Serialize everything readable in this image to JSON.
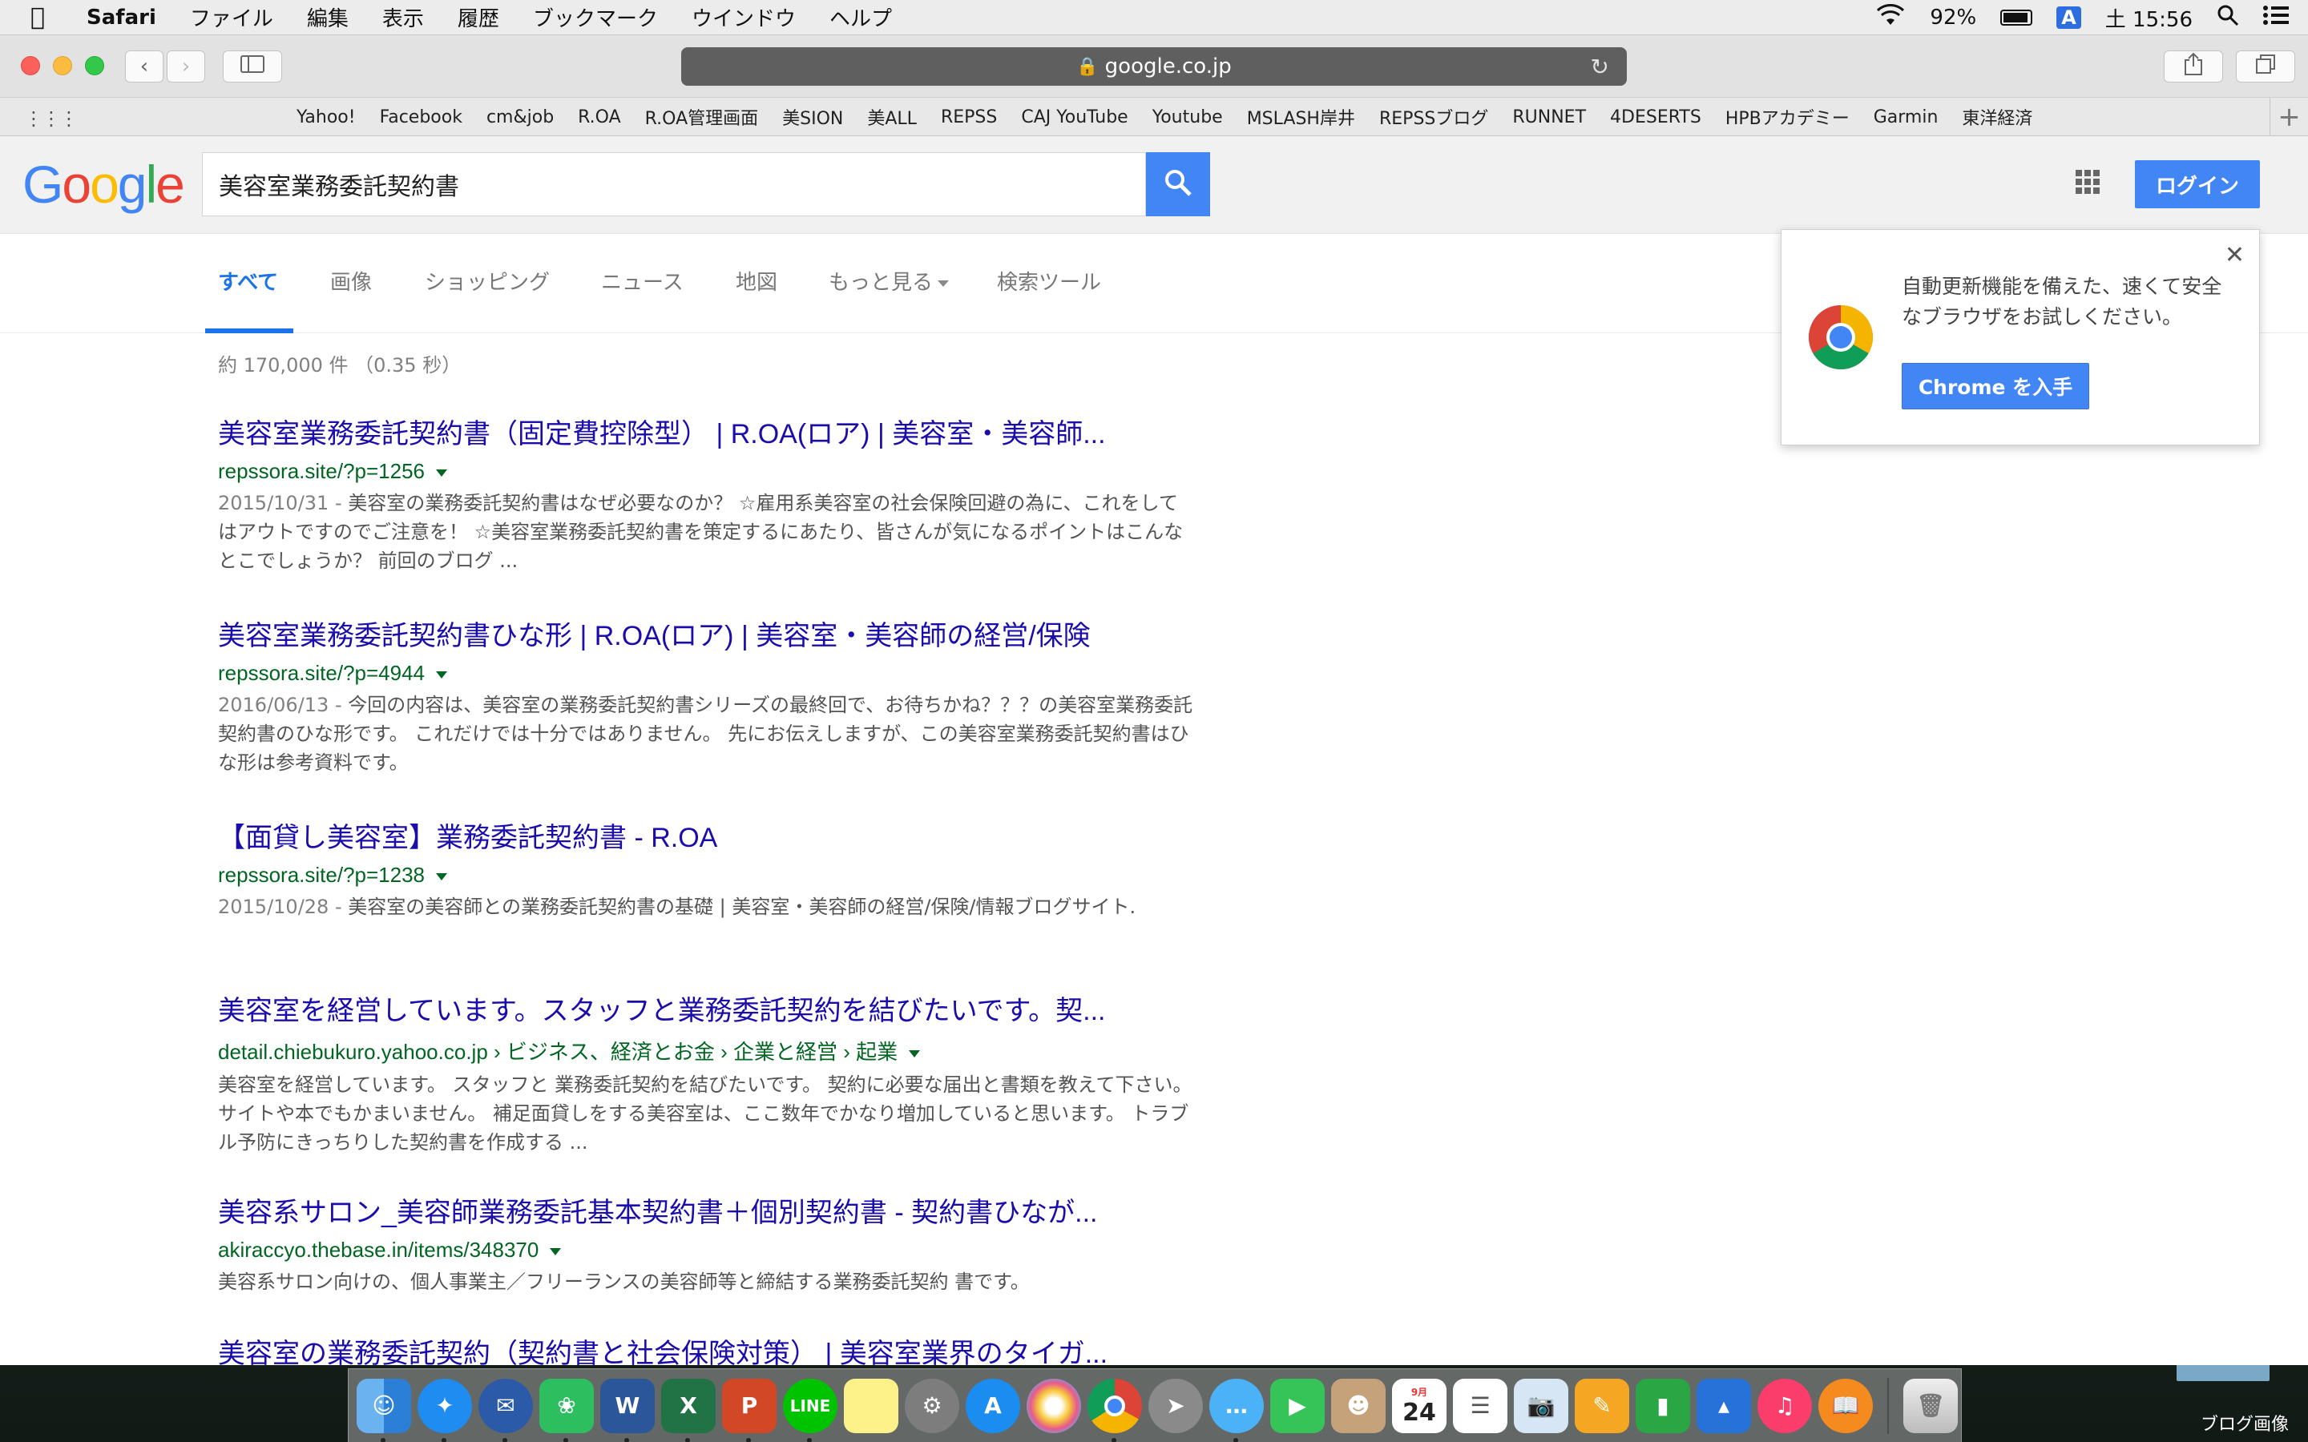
{
  "menubar": {
    "app_name": "Safari",
    "menus": [
      "ファイル",
      "編集",
      "表示",
      "履歴",
      "ブックマーク",
      "ウインドウ",
      "ヘルプ"
    ],
    "battery": "92%",
    "input_mode": "A",
    "clock": "土 15:56"
  },
  "browser": {
    "url": "google.co.jp",
    "bookmarks": [
      "Yahoo!",
      "Facebook",
      "cm&job",
      "R.OA",
      "R.OA管理画面",
      "美SION",
      "美ALL",
      "REPSS",
      "CAJ YouTube",
      "Youtube",
      "MSLASH岸井",
      "REPSSブログ",
      "RUNNET",
      "4DESERTS",
      "HPBアカデミー",
      "Garmin",
      "東洋経済"
    ]
  },
  "google": {
    "logo_letters": [
      "G",
      "o",
      "o",
      "g",
      "l",
      "e"
    ],
    "query": "美容室業務委託契約書",
    "login_label": "ログイン",
    "tabs": [
      "すべて",
      "画像",
      "ショッピング",
      "ニュース",
      "地図",
      "もっと見る",
      "検索ツール"
    ],
    "stats": "約 170,000 件 （0.35 秒）",
    "colors": {
      "blue": "#4285f4",
      "link": "#1a0dab",
      "url_green": "#006621"
    }
  },
  "results": [
    {
      "title": "美容室業務委託契約書（固定費控除型） | R.OA(ロア) | 美容室・美容師...",
      "url": "repssora.site/?p=1256",
      "date": "2015/10/31 - ",
      "snippet": "美容室の業務委託契約書はなぜ必要なのか？ ☆雇用系美容室の社会保険回避の為に、これをしてはアウトですのでご注意を！ ☆美容室業務委託契約書を策定するにあたり、皆さんが気になるポイントはこんなとこでしょうか？ 前回のブログ ..."
    },
    {
      "title": "美容室業務委託契約書ひな形 | R.OA(ロア) | 美容室・美容師の経営/保険",
      "url": "repssora.site/?p=4944",
      "date": "2016/06/13 - ",
      "snippet": "今回の内容は、美容室の業務委託契約書シリーズの最終回で、お待ちかね？？？の美容室業務委託契約書のひな形です。 これだけでは十分ではありません。 先にお伝えしますが、この美容室業務委託契約書はひな形は参考資料です。"
    },
    {
      "title": "【面貸し美容室】業務委託契約書 - R.OA",
      "url": "repssora.site/?p=1238",
      "date": "2015/10/28 - ",
      "snippet": "美容室の美容師との業務委託契約書の基礎 | 美容室・美容師の経営/保険/情報ブログサイト."
    },
    {
      "title": "美容室を経営しています。スタッフと業務委託契約を結びたいです。契...",
      "url": "detail.chiebukuro.yahoo.co.jp › ビジネス、経済とお金 › 企業と経営 › 起業",
      "date": "",
      "snippet": "美容室を経営しています。 スタッフと 業務委託契約を結びたいです。 契約に必要な届出と書類を教えて下さい。 サイトや本でもかまいません。 補足面貸しをする美容室は、ここ数年でかなり増加していると思います。 トラブル予防にきっちりした契約書を作成する ..."
    },
    {
      "title": "美容系サロン_美容師業務委託基本契約書＋個別契約書 - 契約書ひなが...",
      "url": "akiraccyo.thebase.in/items/348370",
      "date": "",
      "snippet": "美容系サロン向けの、個人事業主／フリーランスの美容師等と締結する業務委託契約 書です。"
    },
    {
      "title": "美容室の業務委託契約（契約書と社会保険対策） | 美容室業界のタイガ...",
      "url": "",
      "date": "",
      "snippet": ""
    }
  ],
  "promo": {
    "text": "自動更新機能を備えた、速くて安全なブラウザをお試しください。",
    "button": "Chrome を入手"
  },
  "dock": {
    "calendar_month": "9月",
    "calendar_day": "24",
    "apps": [
      "finder-icon",
      "safari-icon",
      "thunderbird-icon",
      "evernote-icon",
      "word-icon",
      "excel-icon",
      "powerpoint-icon",
      "line-icon",
      "notes-icon",
      "system-preferences-icon",
      "app-store-icon",
      "photos-icon",
      "chrome-icon",
      "launchpad-icon",
      "messages-icon",
      "facetime-icon",
      "contacts-icon",
      "calendar-icon",
      "reminders-icon",
      "preview-icon",
      "pages-icon",
      "numbers-icon",
      "keynote-icon",
      "itunes-icon",
      "ibooks-icon",
      "trash-icon"
    ]
  },
  "desktop": {
    "folder_label": "ブログ画像"
  }
}
